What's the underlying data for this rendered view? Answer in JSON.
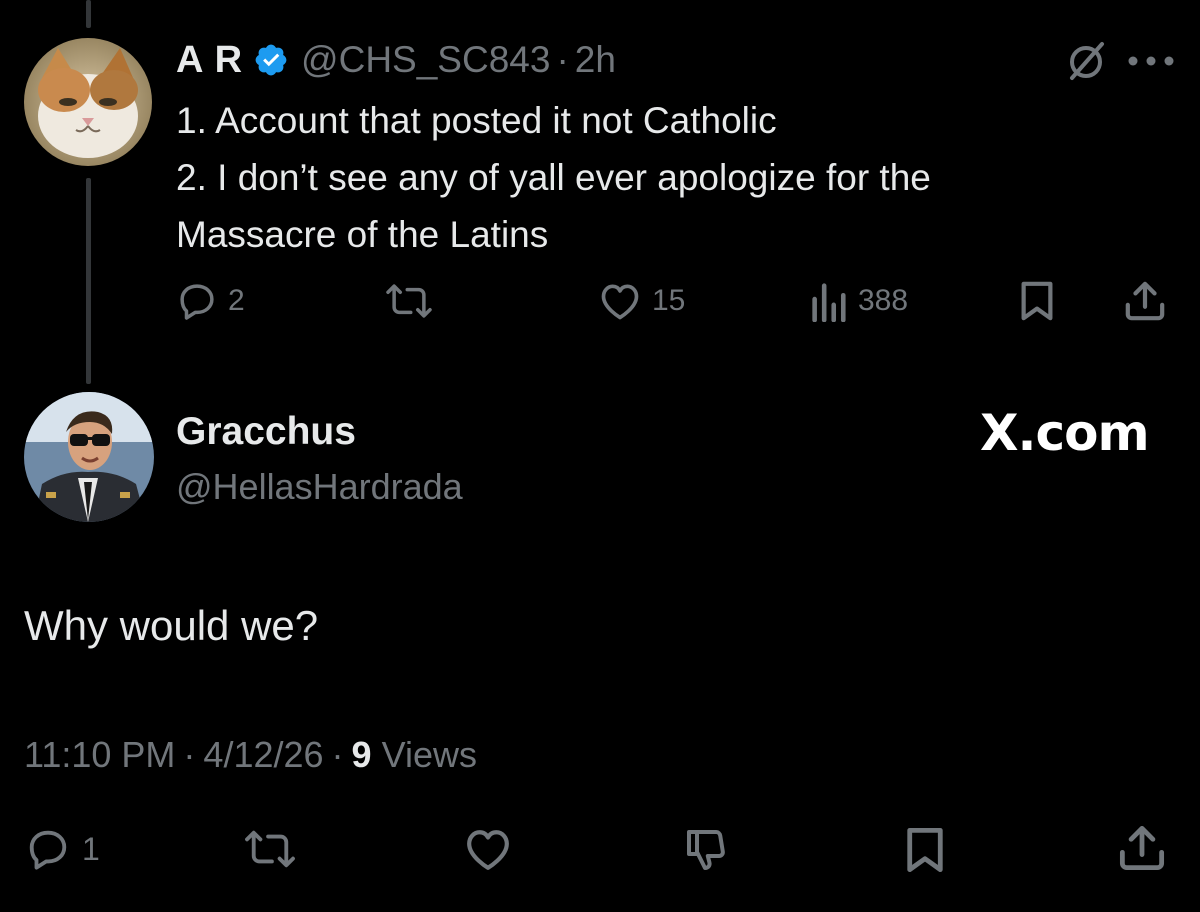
{
  "reply": {
    "name": "A R",
    "handle": "@CHS_SC843",
    "separator": "·",
    "time": "2h",
    "lines": [
      "1. Account that posted it not Catholic",
      "2. I don’t see any of yall ever apologize for the",
      "Massacre of the Latins"
    ],
    "replies_count": "2",
    "likes_count": "15",
    "views_count": "388"
  },
  "main_post": {
    "name": "Gracchus",
    "handle": "@HellasHardrada",
    "brand": "X.com",
    "text": "Why would we?",
    "time": "11:10 PM",
    "date": "4/12/26",
    "separator": "·",
    "views_count": "9",
    "views_label": "Views",
    "replies_count": "1"
  },
  "colors": {
    "background": "#000000",
    "primary_text": "#e7e9ea",
    "secondary_text": "#71767b",
    "verified_badge": "#1d9bf0",
    "thread_line": "#333639"
  },
  "icons": {
    "reply_actions": [
      "reply-icon",
      "repost-icon",
      "like-icon",
      "views-icon",
      "bookmark-icon",
      "share-icon"
    ],
    "main_actions": [
      "reply-icon",
      "repost-icon",
      "like-icon",
      "dislike-icon",
      "bookmark-icon",
      "share-icon"
    ],
    "header": [
      "verified-badge-icon",
      "grok-icon",
      "more-icon"
    ]
  }
}
